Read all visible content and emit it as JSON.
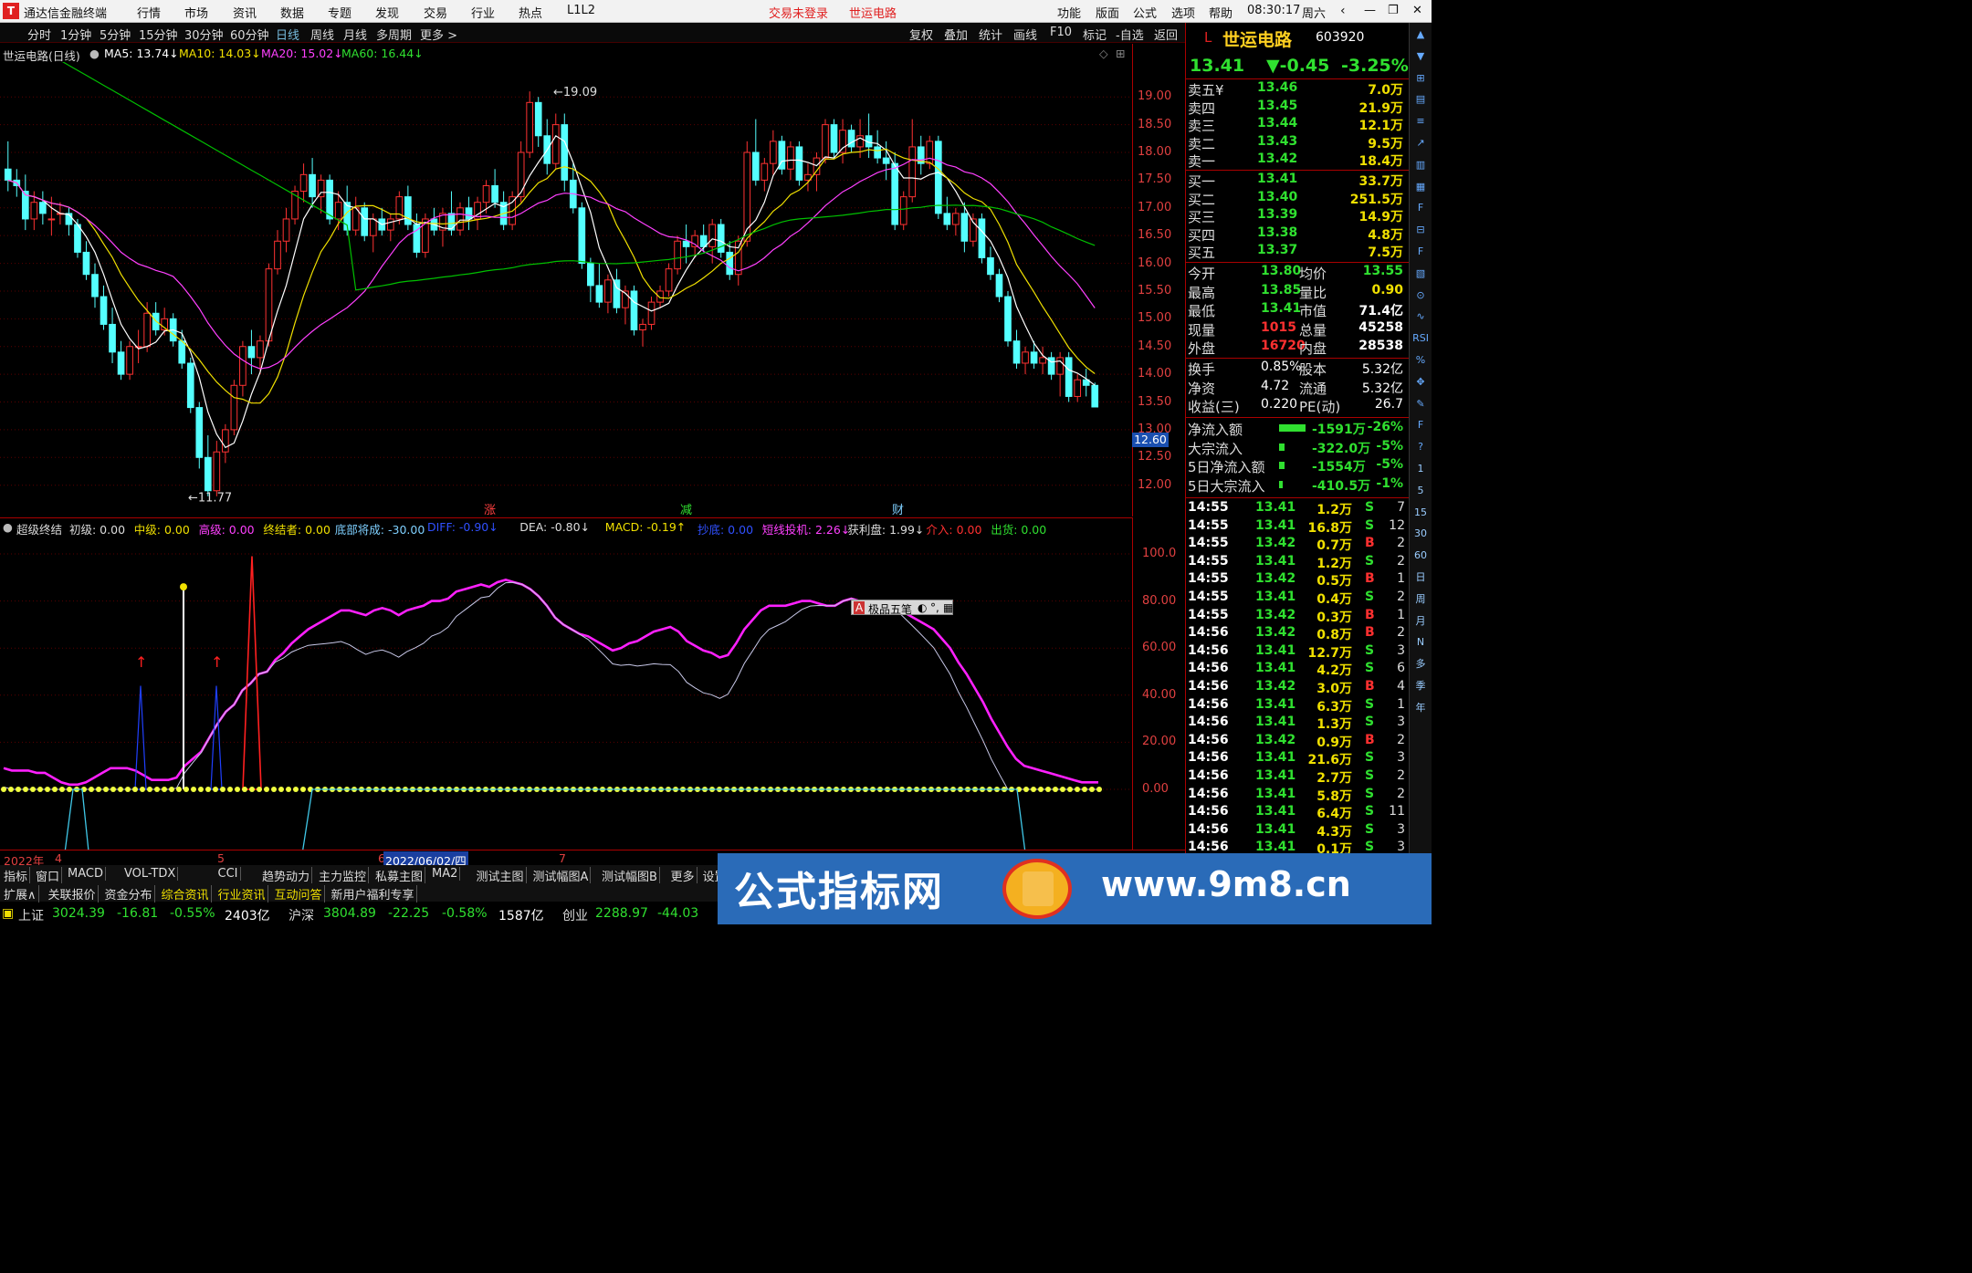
{
  "titlebar": {
    "app_name": "通达信金融终端",
    "menu": [
      "行情",
      "市场",
      "资讯",
      "数据",
      "专题",
      "发现",
      "交易",
      "行业",
      "热点",
      "L1L2"
    ],
    "notice1": "交易未登录",
    "notice2": "世运电路",
    "right_menu": [
      "功能",
      "版面",
      "公式",
      "选项",
      "帮助"
    ],
    "time": "08:30:17",
    "weekday": "周六"
  },
  "toolbar": {
    "periods": [
      "分时",
      "1分钟",
      "5分钟",
      "15分钟",
      "30分钟",
      "60分钟",
      "日线",
      "周线",
      "月线",
      "多周期",
      "更多 >"
    ],
    "active_period": "日线",
    "right": [
      "复权",
      "叠加",
      "统计",
      "画线",
      "F10",
      "标记",
      "-自选",
      "返回"
    ]
  },
  "ma_line": {
    "title": "世运电路(日线)",
    "ma5": "MA5: 13.74↓",
    "ma10": "MA10: 14.03↓",
    "ma20": "MA20: 15.02↓",
    "ma60": "MA60: 16.44↓"
  },
  "main_axis": {
    "ticks": [
      "19.00",
      "18.50",
      "18.00",
      "17.50",
      "17.00",
      "16.50",
      "16.00",
      "15.50",
      "15.00",
      "14.50",
      "14.00",
      "13.50",
      "13.00",
      "12.50",
      "12.00"
    ],
    "current_price": "12.60",
    "high_label": "19.09",
    "low_label": "11.77",
    "markers": [
      "涨",
      "减",
      "财"
    ]
  },
  "indicator_line": {
    "name": "超级终结",
    "items": [
      {
        "label": "初级: 0.00",
        "color": "#dddddd"
      },
      {
        "label": "中级: 0.00",
        "color": "#f0e000"
      },
      {
        "label": "高级: 0.00",
        "color": "#ff40ff"
      },
      {
        "label": "终结者: 0.00",
        "color": "#f0e000"
      },
      {
        "label": "底部将成: -30.00",
        "color": "#7fd0ff"
      },
      {
        "label": "DIFF: -0.90↓",
        "color": "#3050ff"
      },
      {
        "label": "DEA: -0.80↓",
        "color": "#dddddd"
      },
      {
        "label": "MACD: -0.19↑",
        "color": "#f0e000"
      },
      {
        "label": "抄底: 0.00",
        "color": "#3050ff"
      },
      {
        "label": "短线投机: 2.26↓",
        "color": "#ff40ff"
      },
      {
        "label": "获利盘: 1.99↓",
        "color": "#dddddd"
      },
      {
        "label": "介入: 0.00",
        "color": "#ff3030"
      },
      {
        "label": "出货: 0.00",
        "color": "#30e030"
      }
    ]
  },
  "indicator_axis": {
    "ticks": [
      "100.0",
      "80.00",
      "60.00",
      "40.00",
      "20.00",
      "0.00"
    ]
  },
  "popup": {
    "text": "极品五笔"
  },
  "date_axis": {
    "labels": [
      "2022年",
      "4",
      "5",
      "6",
      "2022/06/02/四",
      "7"
    ]
  },
  "tabs_row1": [
    "指标",
    "窗口",
    "MACD",
    "VOL-TDX",
    "CCI",
    "趋势动力",
    "主力监控",
    "私募主图",
    "MA2",
    "测试主图",
    "测试幅图A",
    "测试幅图B",
    "更多",
    "设置"
  ],
  "tabs_row2": [
    "扩展∧",
    "关联报价",
    "资金分布",
    "综合资讯",
    "行业资讯",
    "互动问答",
    "新用户福利专享"
  ],
  "statusbar": {
    "sh": {
      "name": "上证",
      "index": "3024.39",
      "change": "-16.81",
      "pct": "-0.55%",
      "amount": "2403亿"
    },
    "hs": {
      "name": "沪深",
      "index": "3804.89",
      "change": "-22.25",
      "pct": "-0.58%",
      "amount": "1587亿"
    },
    "cy": {
      "name": "创业",
      "index": "2288.97",
      "change": "-44.03"
    }
  },
  "quote": {
    "marker": "L",
    "name": "世运电路",
    "code": "603920",
    "price": "13.41",
    "change": "▼-0.45",
    "pct": "-3.25%",
    "asks": [
      {
        "label": "卖五¥",
        "price": "13.46",
        "vol": "7.0万"
      },
      {
        "label": "卖四",
        "price": "13.45",
        "vol": "21.9万"
      },
      {
        "label": "卖三",
        "price": "13.44",
        "vol": "12.1万"
      },
      {
        "label": "卖二",
        "price": "13.43",
        "vol": "9.5万"
      },
      {
        "label": "卖一",
        "price": "13.42",
        "vol": "18.4万"
      }
    ],
    "bids": [
      {
        "label": "买一",
        "price": "13.41",
        "vol": "33.7万"
      },
      {
        "label": "买二",
        "price": "13.40",
        "vol": "251.5万"
      },
      {
        "label": "买三",
        "price": "13.39",
        "vol": "14.9万"
      },
      {
        "label": "买四",
        "price": "13.38",
        "vol": "4.8万"
      },
      {
        "label": "买五",
        "price": "13.37",
        "vol": "7.5万"
      }
    ],
    "stats1": [
      {
        "l1": "今开",
        "v1": "13.80",
        "l2": "均价",
        "v2": "13.55"
      },
      {
        "l1": "最高",
        "v1": "13.85",
        "l2": "量比",
        "v2": "0.90"
      },
      {
        "l1": "最低",
        "v1": "13.41",
        "l2": "市值",
        "v2": "71.4亿"
      },
      {
        "l1": "现量",
        "v1": "1015",
        "l2": "总量",
        "v2": "45258"
      },
      {
        "l1": "外盘",
        "v1": "16720",
        "l2": "内盘",
        "v2": "28538"
      }
    ],
    "stats2": [
      {
        "l1": "换手",
        "v1": "0.85%",
        "l2": "股本",
        "v2": "5.32亿"
      },
      {
        "l1": "净资",
        "v1": "4.72",
        "l2": "流通",
        "v2": "5.32亿"
      },
      {
        "l1": "收益(三)",
        "v1": "0.220",
        "l2": "PE(动)",
        "v2": "26.7"
      }
    ],
    "flows": [
      {
        "label": "净流入额",
        "value": "-1591万",
        "pct": "-26%",
        "bar": 0.26
      },
      {
        "label": "大宗流入",
        "value": "-322.0万",
        "pct": "-5%",
        "bar": 0.05
      },
      {
        "label": "5日净流入额",
        "value": "-1554万",
        "pct": "-5%",
        "bar": 0.05
      },
      {
        "label": "5日大宗流入",
        "value": "-410.5万",
        "pct": "-1%",
        "bar": 0.01
      }
    ],
    "ticks": [
      {
        "t": "14:55",
        "p": "13.41",
        "v": "1.2万",
        "s": "S",
        "n": "7"
      },
      {
        "t": "14:55",
        "p": "13.41",
        "v": "16.8万",
        "s": "S",
        "n": "12"
      },
      {
        "t": "14:55",
        "p": "13.42",
        "v": "0.7万",
        "s": "B",
        "n": "2"
      },
      {
        "t": "14:55",
        "p": "13.41",
        "v": "1.2万",
        "s": "S",
        "n": "2"
      },
      {
        "t": "14:55",
        "p": "13.42",
        "v": "0.5万",
        "s": "B",
        "n": "1"
      },
      {
        "t": "14:55",
        "p": "13.41",
        "v": "0.4万",
        "s": "S",
        "n": "2"
      },
      {
        "t": "14:55",
        "p": "13.42",
        "v": "0.3万",
        "s": "B",
        "n": "1"
      },
      {
        "t": "14:56",
        "p": "13.42",
        "v": "0.8万",
        "s": "B",
        "n": "2"
      },
      {
        "t": "14:56",
        "p": "13.41",
        "v": "12.7万",
        "s": "S",
        "n": "3"
      },
      {
        "t": "14:56",
        "p": "13.41",
        "v": "4.2万",
        "s": "S",
        "n": "6"
      },
      {
        "t": "14:56",
        "p": "13.42",
        "v": "3.0万",
        "s": "B",
        "n": "4"
      },
      {
        "t": "14:56",
        "p": "13.41",
        "v": "6.3万",
        "s": "S",
        "n": "1"
      },
      {
        "t": "14:56",
        "p": "13.41",
        "v": "1.3万",
        "s": "S",
        "n": "3"
      },
      {
        "t": "14:56",
        "p": "13.42",
        "v": "0.9万",
        "s": "B",
        "n": "2"
      },
      {
        "t": "14:56",
        "p": "13.41",
        "v": "21.6万",
        "s": "S",
        "n": "3"
      },
      {
        "t": "14:56",
        "p": "13.41",
        "v": "2.7万",
        "s": "S",
        "n": "2"
      },
      {
        "t": "14:56",
        "p": "13.41",
        "v": "5.8万",
        "s": "S",
        "n": "2"
      },
      {
        "t": "14:56",
        "p": "13.41",
        "v": "6.4万",
        "s": "S",
        "n": "11"
      },
      {
        "t": "14:56",
        "p": "13.41",
        "v": "4.3万",
        "s": "S",
        "n": "3"
      },
      {
        "t": "14:56",
        "p": "13.41",
        "v": "0.1万",
        "s": "S",
        "n": "3"
      }
    ]
  },
  "sidebar": [
    "▲",
    "▼",
    "⊞",
    "▤",
    "≡",
    "↗",
    "▥",
    "▦",
    "F",
    "⊟",
    "F",
    "▧",
    "⊙",
    "∿",
    "RSI",
    "%",
    "✥",
    "✎",
    "F",
    "?",
    "1",
    "5",
    "15",
    "30",
    "60",
    "日",
    "周",
    "月",
    "N",
    "多",
    "季",
    "年"
  ],
  "banner": {
    "title": "公式指标网",
    "url": "www.9m8.cn"
  },
  "colors": {
    "up": "#ff3232",
    "down": "#54ffff",
    "ma5": "#ffffff",
    "ma10": "#f0e000",
    "ma20": "#ff40ff",
    "ma60": "#00c000"
  },
  "chart_data": {
    "type": "candlestick",
    "price_range": [
      11.6,
      19.3
    ],
    "candles": [
      [
        17.7,
        18.2,
        17.3,
        17.5
      ],
      [
        17.5,
        17.7,
        17.2,
        17.4
      ],
      [
        17.3,
        17.6,
        16.6,
        16.8
      ],
      [
        16.8,
        17.3,
        16.6,
        17.1
      ],
      [
        17.1,
        17.3,
        16.7,
        16.9
      ],
      [
        16.8,
        17.2,
        16.5,
        16.8
      ],
      [
        16.9,
        17.1,
        16.7,
        16.9
      ],
      [
        16.9,
        17.0,
        16.5,
        16.7
      ],
      [
        16.7,
        16.8,
        16.1,
        16.2
      ],
      [
        16.2,
        16.4,
        15.7,
        15.8
      ],
      [
        15.8,
        16.0,
        15.2,
        15.4
      ],
      [
        15.4,
        15.6,
        14.8,
        14.9
      ],
      [
        14.9,
        15.2,
        14.2,
        14.4
      ],
      [
        14.4,
        14.6,
        13.9,
        14.0
      ],
      [
        14.0,
        14.6,
        13.9,
        14.5
      ],
      [
        14.5,
        14.8,
        14.2,
        14.5
      ],
      [
        14.5,
        15.3,
        14.4,
        15.1
      ],
      [
        15.1,
        15.3,
        14.7,
        14.8
      ],
      [
        14.8,
        15.2,
        14.7,
        15.0
      ],
      [
        15.0,
        15.1,
        14.5,
        14.6
      ],
      [
        14.6,
        14.8,
        14.1,
        14.2
      ],
      [
        14.2,
        14.3,
        13.3,
        13.4
      ],
      [
        13.4,
        13.5,
        12.3,
        12.5
      ],
      [
        12.5,
        12.9,
        11.8,
        11.9
      ],
      [
        11.9,
        12.8,
        11.8,
        12.6
      ],
      [
        12.6,
        13.1,
        12.4,
        13.0
      ],
      [
        13.0,
        13.9,
        12.9,
        13.8
      ],
      [
        13.8,
        14.6,
        13.6,
        14.5
      ],
      [
        14.5,
        14.8,
        14.0,
        14.3
      ],
      [
        14.3,
        14.7,
        14.0,
        14.6
      ],
      [
        14.6,
        16.0,
        14.5,
        15.9
      ],
      [
        15.9,
        16.6,
        15.8,
        16.4
      ],
      [
        16.4,
        17.0,
        16.2,
        16.8
      ],
      [
        16.8,
        17.4,
        16.7,
        17.3
      ],
      [
        17.3,
        17.8,
        17.1,
        17.6
      ],
      [
        17.6,
        17.9,
        17.0,
        17.2
      ],
      [
        17.2,
        17.6,
        16.9,
        17.5
      ],
      [
        17.5,
        17.6,
        16.7,
        16.8
      ],
      [
        16.8,
        17.3,
        16.6,
        17.1
      ],
      [
        17.1,
        17.4,
        16.5,
        16.6
      ],
      [
        16.6,
        17.2,
        16.5,
        17.0
      ],
      [
        17.0,
        17.1,
        16.4,
        16.5
      ],
      [
        16.5,
        16.9,
        16.2,
        16.8
      ],
      [
        16.8,
        17.0,
        16.5,
        16.6
      ],
      [
        16.6,
        16.9,
        16.4,
        16.8
      ],
      [
        16.8,
        17.3,
        16.7,
        17.2
      ],
      [
        17.2,
        17.4,
        16.6,
        16.7
      ],
      [
        16.7,
        16.9,
        16.1,
        16.2
      ],
      [
        16.2,
        16.9,
        16.1,
        16.8
      ],
      [
        16.8,
        17.0,
        16.5,
        16.6
      ],
      [
        16.6,
        17.0,
        16.3,
        16.9
      ],
      [
        16.9,
        17.3,
        16.5,
        16.6
      ],
      [
        16.6,
        17.1,
        16.5,
        17.0
      ],
      [
        17.0,
        17.2,
        16.6,
        16.8
      ],
      [
        16.8,
        17.2,
        16.6,
        17.1
      ],
      [
        17.1,
        17.5,
        16.9,
        17.4
      ],
      [
        17.4,
        17.7,
        17.0,
        17.1
      ],
      [
        17.1,
        17.3,
        16.6,
        16.7
      ],
      [
        16.7,
        17.3,
        16.6,
        17.2
      ],
      [
        17.2,
        18.2,
        17.1,
        18.0
      ],
      [
        18.0,
        19.1,
        17.9,
        18.9
      ],
      [
        18.9,
        19.0,
        18.1,
        18.3
      ],
      [
        18.3,
        18.6,
        17.6,
        17.8
      ],
      [
        17.8,
        18.7,
        17.7,
        18.5
      ],
      [
        18.5,
        18.7,
        17.3,
        17.5
      ],
      [
        17.5,
        17.8,
        16.9,
        17.0
      ],
      [
        17.0,
        17.1,
        15.9,
        16.0
      ],
      [
        16.0,
        16.1,
        15.3,
        15.6
      ],
      [
        15.6,
        16.0,
        15.2,
        15.3
      ],
      [
        15.3,
        15.8,
        15.1,
        15.7
      ],
      [
        15.7,
        15.9,
        15.1,
        15.2
      ],
      [
        15.2,
        15.6,
        14.9,
        15.5
      ],
      [
        15.5,
        15.6,
        14.7,
        14.8
      ],
      [
        14.8,
        15.0,
        14.5,
        14.9
      ],
      [
        14.9,
        15.4,
        14.8,
        15.3
      ],
      [
        15.3,
        15.6,
        15.2,
        15.5
      ],
      [
        15.5,
        16.0,
        15.4,
        15.9
      ],
      [
        15.9,
        16.5,
        15.8,
        16.4
      ],
      [
        16.4,
        16.7,
        16.0,
        16.3
      ],
      [
        16.3,
        16.6,
        16.1,
        16.5
      ],
      [
        16.5,
        16.7,
        16.2,
        16.3
      ],
      [
        16.3,
        16.8,
        16.0,
        16.7
      ],
      [
        16.7,
        16.8,
        16.1,
        16.2
      ],
      [
        16.2,
        16.4,
        15.7,
        15.8
      ],
      [
        15.8,
        16.5,
        15.6,
        16.4
      ],
      [
        16.4,
        18.2,
        16.3,
        18.0
      ],
      [
        18.0,
        18.6,
        17.4,
        17.5
      ],
      [
        17.5,
        17.9,
        17.3,
        17.8
      ],
      [
        17.8,
        18.4,
        17.6,
        18.2
      ],
      [
        18.2,
        18.3,
        17.6,
        17.7
      ],
      [
        17.7,
        18.2,
        17.5,
        18.1
      ],
      [
        18.1,
        18.2,
        17.4,
        17.5
      ],
      [
        17.5,
        17.8,
        17.3,
        17.6
      ],
      [
        17.6,
        18.0,
        17.3,
        17.9
      ],
      [
        17.9,
        18.6,
        17.8,
        18.5
      ],
      [
        18.5,
        18.6,
        17.9,
        18.0
      ],
      [
        18.0,
        18.6,
        17.8,
        18.4
      ],
      [
        18.4,
        18.5,
        18.0,
        18.1
      ],
      [
        18.1,
        18.6,
        17.9,
        18.3
      ],
      [
        18.3,
        18.7,
        17.9,
        18.1
      ],
      [
        18.1,
        18.4,
        17.8,
        17.9
      ],
      [
        17.9,
        18.2,
        17.5,
        17.8
      ],
      [
        17.8,
        18.0,
        16.6,
        16.7
      ],
      [
        16.7,
        17.3,
        16.6,
        17.2
      ],
      [
        17.2,
        18.6,
        17.1,
        18.1
      ],
      [
        18.1,
        18.3,
        17.6,
        17.8
      ],
      [
        17.8,
        18.3,
        17.7,
        18.2
      ],
      [
        18.2,
        18.3,
        16.8,
        16.9
      ],
      [
        16.9,
        17.2,
        16.6,
        16.7
      ],
      [
        16.7,
        17.0,
        16.5,
        16.9
      ],
      [
        16.9,
        17.1,
        16.2,
        16.4
      ],
      [
        16.4,
        16.9,
        16.3,
        16.8
      ],
      [
        16.8,
        16.9,
        16.0,
        16.1
      ],
      [
        16.1,
        16.3,
        15.7,
        15.8
      ],
      [
        15.8,
        15.9,
        15.3,
        15.4
      ],
      [
        15.4,
        15.5,
        14.5,
        14.6
      ],
      [
        14.6,
        14.8,
        14.1,
        14.2
      ],
      [
        14.2,
        14.5,
        14.0,
        14.4
      ],
      [
        14.4,
        14.6,
        14.1,
        14.2
      ],
      [
        14.2,
        14.5,
        14.0,
        14.3
      ],
      [
        14.3,
        14.4,
        13.9,
        14.0
      ],
      [
        14.0,
        14.4,
        13.6,
        14.3
      ],
      [
        14.3,
        14.4,
        13.5,
        13.6
      ],
      [
        13.6,
        14.0,
        13.5,
        13.9
      ],
      [
        13.9,
        14.1,
        13.6,
        13.8
      ],
      [
        13.8,
        13.85,
        13.41,
        13.41
      ]
    ],
    "ind_upper": [
      9,
      8,
      8,
      8,
      7,
      7,
      5,
      3,
      2,
      2,
      3,
      5,
      7,
      9,
      9,
      9,
      8,
      6,
      4,
      4,
      4,
      5,
      10,
      13,
      16,
      22,
      28,
      33,
      36,
      42,
      45,
      49,
      50,
      55,
      58,
      62,
      65,
      68,
      70,
      72,
      74,
      76,
      76,
      75,
      74,
      76,
      77,
      76,
      74,
      76,
      77,
      78,
      80,
      80,
      81,
      84,
      85,
      86,
      87,
      86,
      88,
      89,
      88,
      87,
      85,
      82,
      78,
      73,
      70,
      68,
      66,
      65,
      63,
      61,
      59,
      60,
      62,
      63,
      65,
      67,
      68,
      69,
      67,
      63,
      61,
      59,
      58,
      56,
      57,
      62,
      68,
      72,
      76,
      78,
      78,
      78,
      79,
      80,
      80,
      79,
      78,
      78,
      80,
      81,
      80,
      79,
      78,
      79,
      78,
      76,
      74,
      72,
      70,
      68,
      64,
      60,
      54,
      49,
      43,
      37,
      30,
      24,
      18,
      13,
      10,
      9,
      8,
      7,
      6,
      5,
      4,
      3,
      3,
      3
    ]
  }
}
